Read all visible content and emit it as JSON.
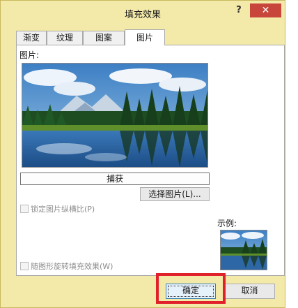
{
  "dialog": {
    "title": "填充效果",
    "help_label": "?",
    "close_label": "✕"
  },
  "tabs": [
    {
      "label": "渐变",
      "active": false
    },
    {
      "label": "纹理",
      "active": false
    },
    {
      "label": "图案",
      "active": false
    },
    {
      "label": "图片",
      "active": true
    }
  ],
  "picture_panel": {
    "picture_label": "图片:",
    "capture_label": "捕获",
    "select_picture_label": "选择图片(L)...",
    "lock_aspect_label": "锁定图片纵横比(P)",
    "lock_aspect_checked": false,
    "rotate_with_shape_label": "随图形旋转填充效果(W)",
    "rotate_with_shape_checked": false,
    "example_label": "示例:"
  },
  "footer": {
    "ok_label": "确定",
    "cancel_label": "取消"
  },
  "colors": {
    "dialog_background": "#f3e9a9",
    "close_button": "#c7453b",
    "highlight_box": "#e0202a",
    "default_button_border": "#3c7fb1"
  }
}
